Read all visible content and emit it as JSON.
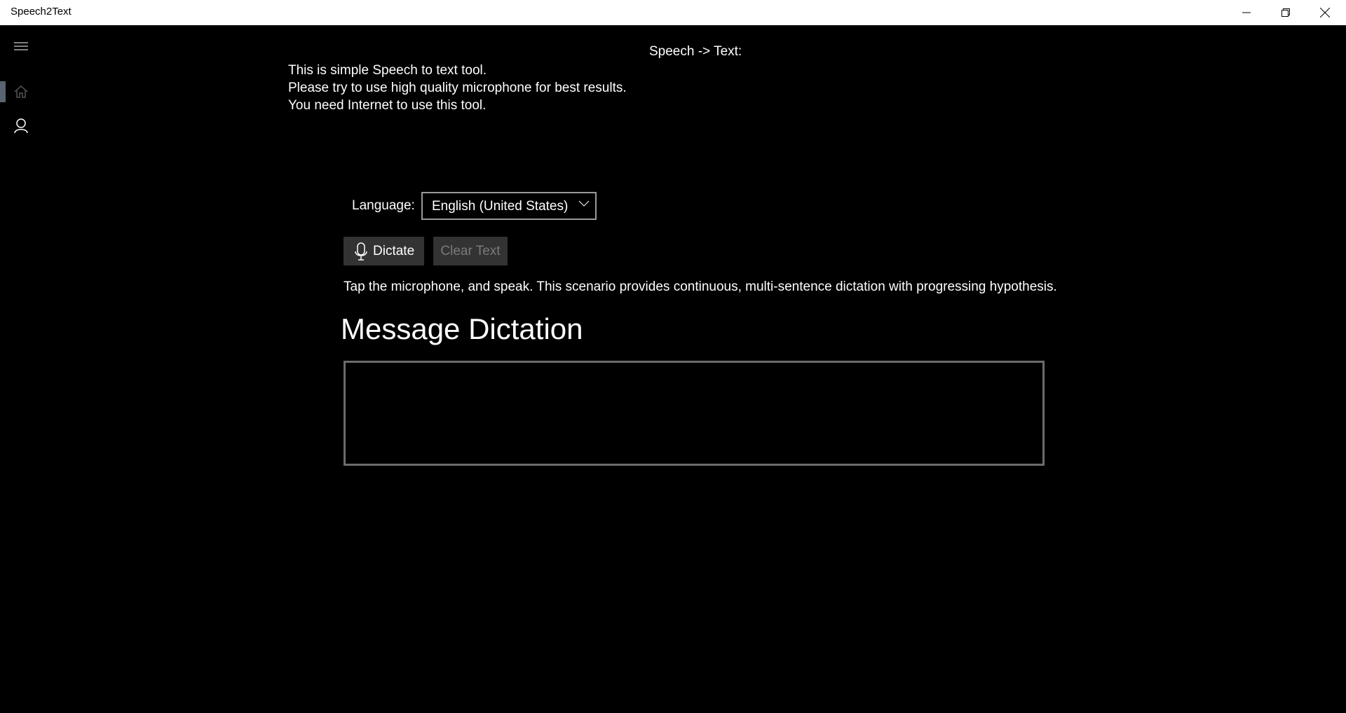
{
  "window": {
    "title": "Speech2Text",
    "controls": {
      "minimize": "minimize-icon",
      "restore": "restore-icon",
      "close": "close-icon"
    }
  },
  "sidebar": {
    "items": [
      {
        "name": "menu",
        "icon": "hamburger-icon"
      },
      {
        "name": "home",
        "icon": "home-icon",
        "selected": true
      },
      {
        "name": "account",
        "icon": "user-icon"
      }
    ],
    "accent": "#5a6470"
  },
  "header": {
    "title": "Speech -> Text:"
  },
  "intro": {
    "lines": [
      "This is simple Speech to text tool.",
      "Please try to use high quality microphone for best results.",
      "You need Internet to use this tool."
    ]
  },
  "language": {
    "label": "Language:",
    "selected": "English (United States)"
  },
  "buttons": {
    "dictate": {
      "label": "Dictate",
      "icon": "microphone-icon"
    },
    "clear": {
      "label": "Clear Text",
      "disabled": true
    }
  },
  "hint": "Tap the microphone, and speak. This scenario provides continuous, multi-sentence dictation with progressing hypothesis.",
  "dictation": {
    "heading": "Message Dictation",
    "value": ""
  }
}
